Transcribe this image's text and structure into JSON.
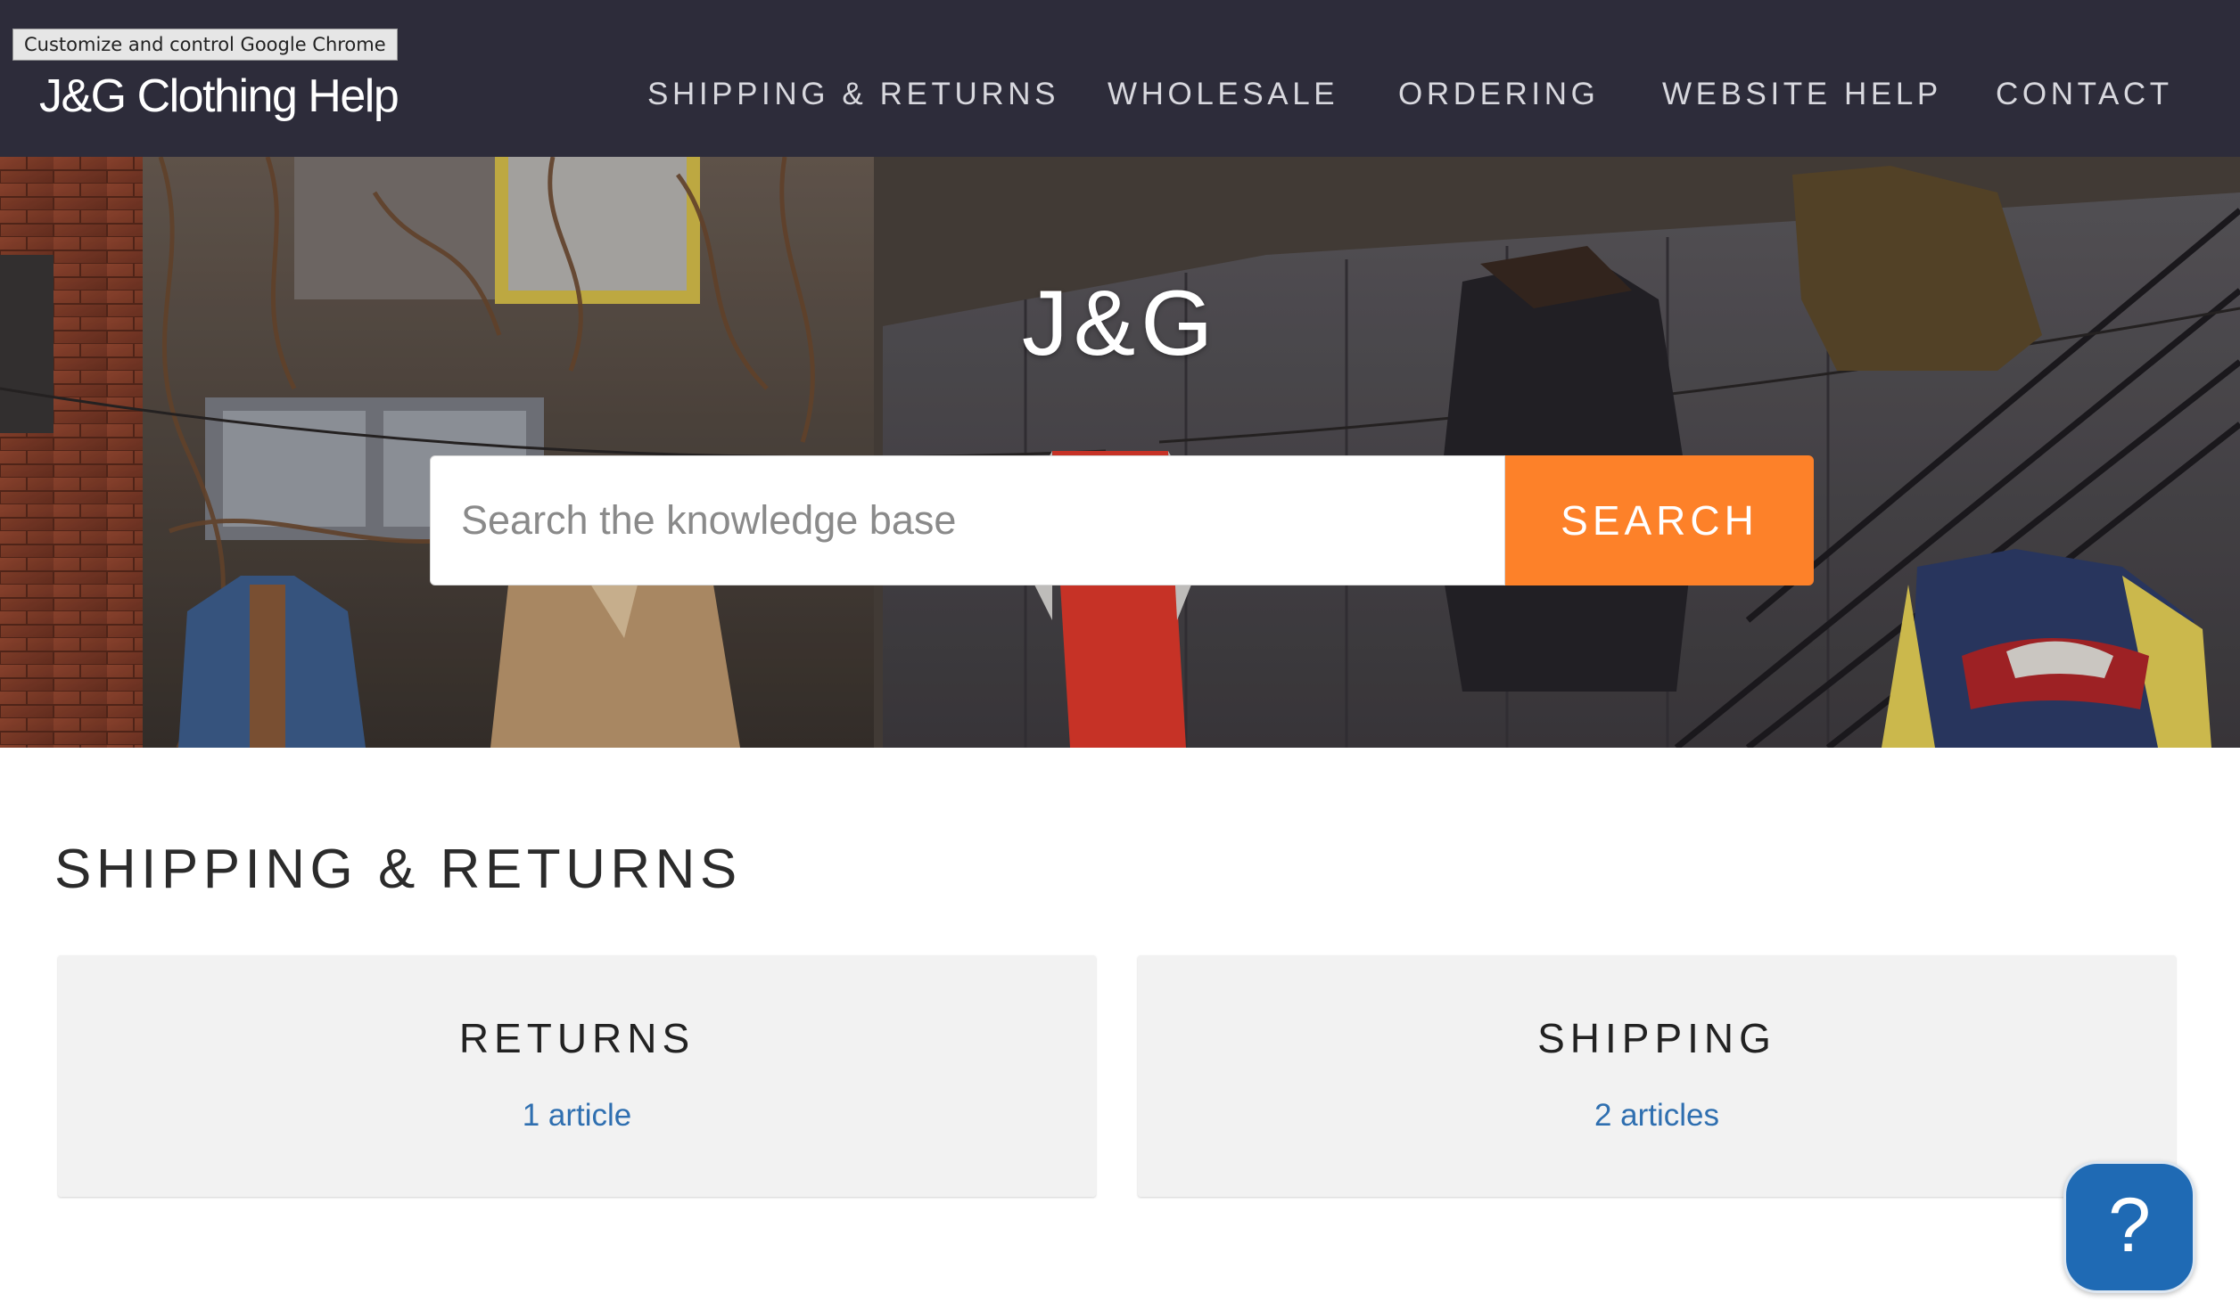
{
  "tooltip": {
    "text": "Customize and control Google Chrome"
  },
  "header": {
    "brand": "J&G Clothing Help",
    "nav": [
      {
        "label": "SHIPPING & RETURNS"
      },
      {
        "label": "WHOLESALE"
      },
      {
        "label": "ORDERING"
      },
      {
        "label": "WEBSITE HELP"
      },
      {
        "label": "CONTACT"
      }
    ]
  },
  "hero": {
    "title": "J&G",
    "search": {
      "placeholder": "Search the knowledge base",
      "value": "",
      "button_label": "SEARCH"
    }
  },
  "section": {
    "title": "SHIPPING & RETURNS",
    "cards": [
      {
        "title": "RETURNS",
        "link": "1 article"
      },
      {
        "title": "SHIPPING",
        "link": "2 articles"
      }
    ]
  },
  "help_widget": {
    "glyph": "?",
    "icon": "question-mark-icon"
  },
  "colors": {
    "header_bg": "#2d2c3a",
    "search_button": "#fd8129",
    "link": "#2f6fb0",
    "card_bg": "#f2f2f2",
    "help_button": "#1f6ab4"
  }
}
